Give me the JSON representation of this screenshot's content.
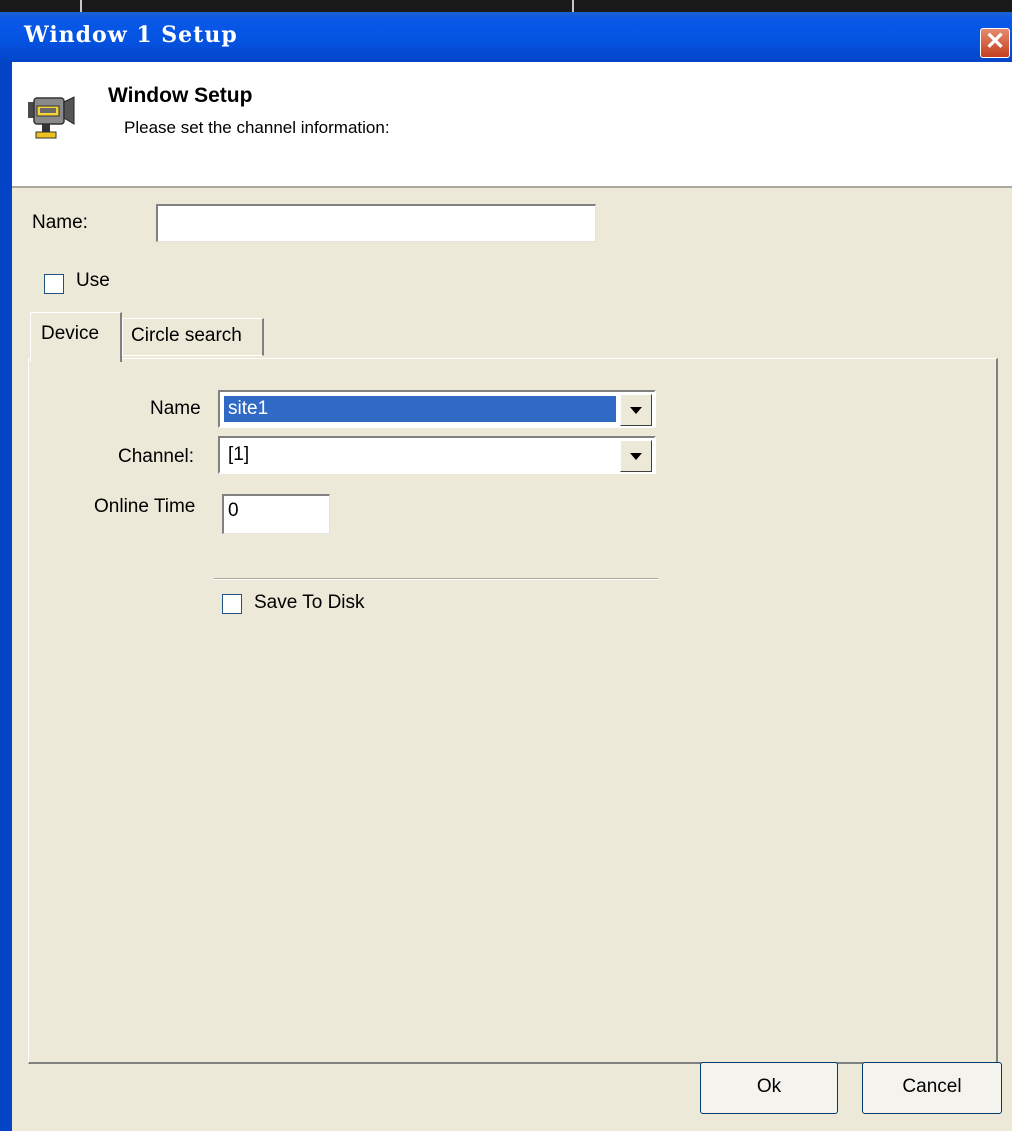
{
  "window": {
    "title": "Window 1 Setup",
    "close_symbol": "✕"
  },
  "header": {
    "icon": "camera-icon",
    "title": "Window Setup",
    "subtitle": "Please set the channel information:"
  },
  "form": {
    "name_label": "Name:",
    "name_value": "",
    "use_label": "Use",
    "use_checked": false
  },
  "tabs": [
    {
      "label": "Device",
      "active": true
    },
    {
      "label": "Circle search",
      "active": false
    }
  ],
  "device": {
    "name_label": "Name",
    "name_value": "site1",
    "channel_label": "Channel:",
    "channel_value": "[1]",
    "online_time_label": "Online Time",
    "online_time_value": "0",
    "save_label": "Save To Disk",
    "save_checked": false
  },
  "buttons": {
    "ok": "Ok",
    "cancel": "Cancel"
  },
  "colors": {
    "titlebar": "#0452e0",
    "dialog": "#ece9d8",
    "selection": "#316ac5"
  }
}
